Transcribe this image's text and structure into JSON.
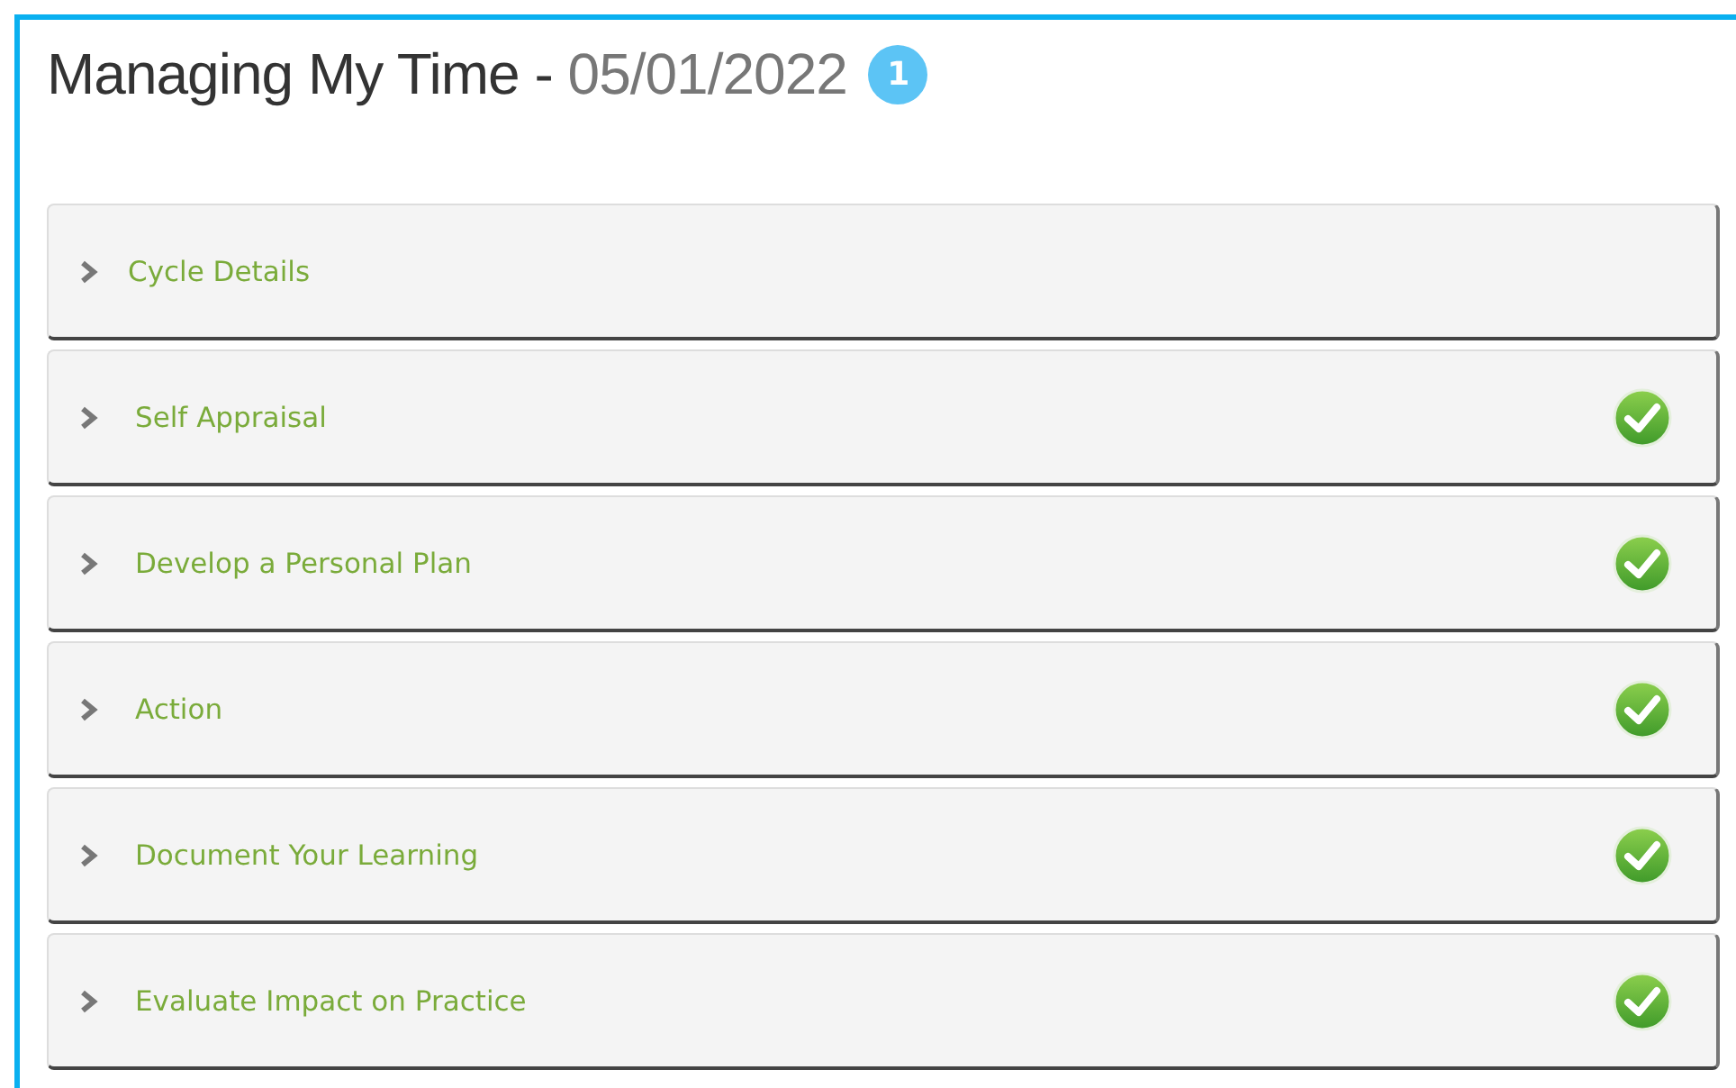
{
  "title": {
    "name": "Managing My Time - ",
    "date": "05/01/2022",
    "badge": "1"
  },
  "sections": [
    {
      "label": "Cycle Details",
      "completed": false,
      "expanded": false
    },
    {
      "label": "Self Appraisal",
      "completed": true,
      "expanded": false
    },
    {
      "label": "Develop a Personal Plan",
      "completed": true,
      "expanded": false
    },
    {
      "label": "Action",
      "completed": true,
      "expanded": false
    },
    {
      "label": "Document Your Learning",
      "completed": true,
      "expanded": false
    },
    {
      "label": "Evaluate Impact on Practice",
      "completed": true,
      "expanded": false
    }
  ]
}
